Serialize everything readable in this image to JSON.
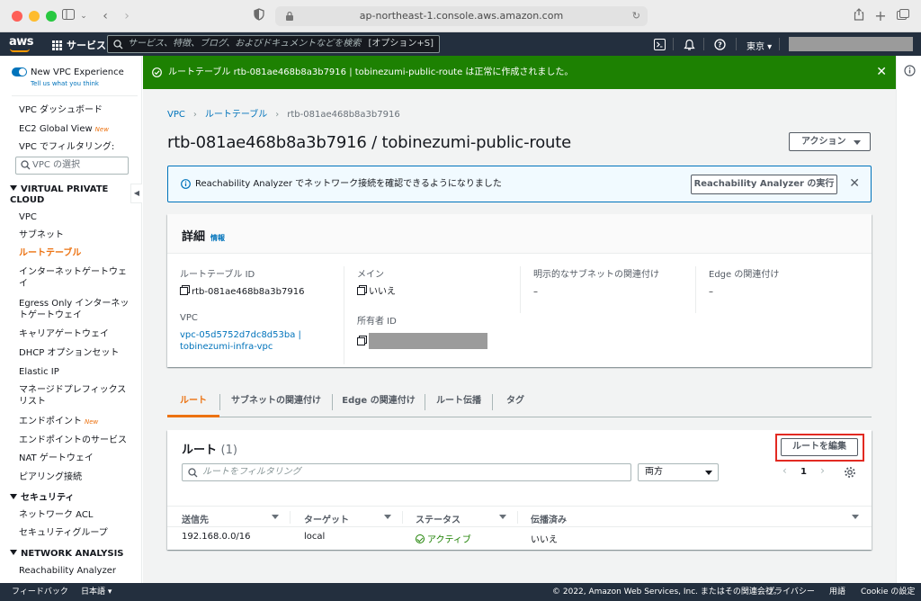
{
  "browser": {
    "url": "ap-northeast-1.console.aws.amazon.com"
  },
  "awsnav": {
    "logo": "aws",
    "services_label": "サービス",
    "search_placeholder": "サービス、特徴、ブログ、およびドキュメントなどを検索",
    "search_shortcut": "[オプション+S]",
    "region": "東京 ▾"
  },
  "sidebar": {
    "new_experience": "New VPC Experience",
    "tell_us": "Tell us what you think",
    "new_badge": "New",
    "items": {
      "dashboard": "VPC ダッシュボード",
      "ec2_global": "EC2 Global View",
      "filter_label": "VPC でフィルタリング:",
      "filter_placeholder": "VPC の選択",
      "sect_vpc": "VIRTUAL PRIVATE CLOUD",
      "vpc": "VPC",
      "subnet": "サブネット",
      "route_table": "ルートテーブル",
      "igw": "インターネットゲートウェイ",
      "egress": "Egress Only インターネットゲートウェイ",
      "cgw": "キャリアゲートウェイ",
      "dhcp": "DHCP オプションセット",
      "eip": "Elastic IP",
      "prefix": "マネージドプレフィックスリスト",
      "endpoint": "エンドポイント",
      "endpoint_svc": "エンドポイントのサービス",
      "nat": "NAT ゲートウェイ",
      "peering": "ピアリング接続",
      "sect_security": "セキュリティ",
      "nacl": "ネットワーク ACL",
      "sg": "セキュリティグループ",
      "sect_network": "NETWORK ANALYSIS",
      "reachability": "Reachability Analyzer"
    }
  },
  "flash": {
    "message": "ルートテーブル rtb-081ae468b8a3b7916 | tobinezumi-public-route は正常に作成されました。"
  },
  "breadcrumb": {
    "vpc": "VPC",
    "route_tables": "ルートテーブル",
    "current": "rtb-081ae468b8a3b7916"
  },
  "page": {
    "title": "rtb-081ae468b8a3b7916 / tobinezumi-public-route",
    "actions_label": "アクション"
  },
  "infobar": {
    "message": "Reachability Analyzer でネットワーク接続を確認できるようになりました",
    "button": "Reachability Analyzer の実行"
  },
  "details": {
    "title": "詳細",
    "info": "情報",
    "rtb_id_label": "ルートテーブル ID",
    "rtb_id": "rtb-081ae468b8a3b7916",
    "vpc_label": "VPC",
    "vpc_value_1": "vpc-05d5752d7dc8d53ba |",
    "vpc_value_2": "tobinezumi-infra-vpc",
    "main_label": "メイン",
    "main_value": "いいえ",
    "owner_label": "所有者 ID",
    "explicit_label": "明示的なサブネットの関連付け",
    "explicit_value": "–",
    "edge_label": "Edge の関連付け",
    "edge_value": "–"
  },
  "tabs": [
    "ルート",
    "サブネットの関連付け",
    "Edge の関連付け",
    "ルート伝播",
    "タグ"
  ],
  "routes": {
    "title": "ルート",
    "count": "(1)",
    "edit_button": "ルートを編集",
    "filter_placeholder": "ルートをフィルタリング",
    "select_value": "両方",
    "page": "1",
    "columns": [
      "送信先",
      "ターゲット",
      "ステータス",
      "伝播済み"
    ],
    "rows": [
      {
        "destination": "192.168.0.0/16",
        "target": "local",
        "status": "アクティブ",
        "propagated": "いいえ"
      }
    ]
  },
  "footer": {
    "feedback": "フィードバック",
    "language": "日本語 ▾",
    "copyright": "© 2022, Amazon Web Services, Inc. またはその関連会社。",
    "privacy": "プライバシー",
    "terms": "用語",
    "cookies": "Cookie の設定"
  },
  "colors": {
    "aws_nav": "#232f3e",
    "success": "#1d8102",
    "accent": "#ec7211",
    "link": "#0073bb",
    "highlight": "#e22a22"
  }
}
